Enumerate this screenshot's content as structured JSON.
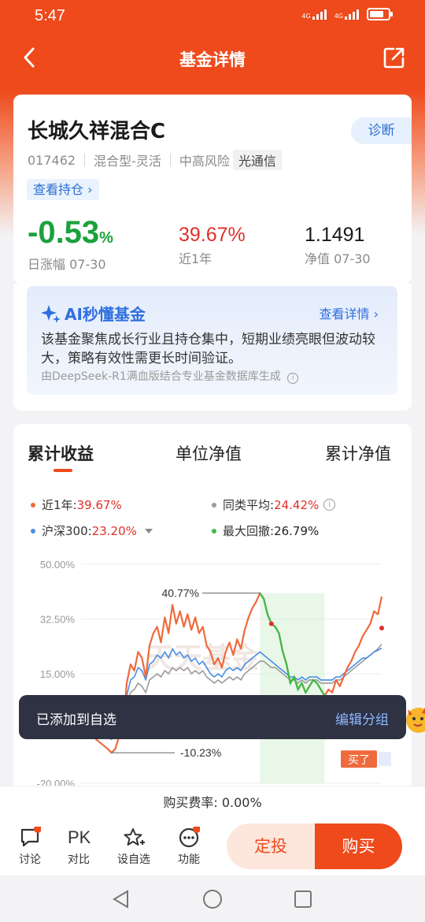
{
  "status_bar": {
    "time": "5:47",
    "signal1": "4G",
    "signal2": "4G"
  },
  "nav": {
    "title": "基金详情"
  },
  "fund": {
    "name": "长城久祥混合C",
    "diagnose": "诊断",
    "code": "017462",
    "type": "混合型-灵活",
    "risk": "中高风险",
    "manager_tag": "光通信",
    "holdings_link": "查看持仓 ›",
    "daily_change_value": "-0.53",
    "daily_change_unit": "%",
    "daily_change_label": "日涨幅 07-30",
    "year_return": "39.67%",
    "year_return_label": "近1年",
    "nav_value": "1.1491",
    "nav_label": "净值 07-30"
  },
  "ai": {
    "title": "AI秒懂基金",
    "more": "查看详情 ›",
    "text": "该基金聚焦成长行业且持仓集中，短期业绩亮眼但波动较大，策略有效性需更长时间验证。",
    "note": "由DeepSeek-R1满血版结合专业基金数据库生成"
  },
  "chart_tabs": [
    "累计收益",
    "单位净值",
    "累计净值"
  ],
  "legend": {
    "fund_label": "近1年:",
    "fund_value": "39.67%",
    "peer_label": "同类平均:",
    "peer_value": "24.42%",
    "index_label": "沪深300:",
    "index_value": "23.20%",
    "drawdown_label": "最大回撤:",
    "drawdown_value": "26.79%"
  },
  "chart_data": {
    "type": "line",
    "y_tick_labels": [
      "50.00%",
      "32.50%",
      "15.00%",
      "-20.00%"
    ],
    "ylim": [
      -20,
      50
    ],
    "annotations": {
      "max": "40.77%",
      "min": "-10.23%"
    },
    "watermark": "天天基金",
    "buy_marker": "买了",
    "colors": {
      "fund": "#ef6a3c",
      "peer": "#9b9b9b",
      "index": "#4a8ee6",
      "drawdown": "#3dbb47"
    },
    "series": [
      {
        "name": "近1年",
        "values": [
          -2,
          -3,
          -5,
          -4,
          -6,
          -7,
          -8,
          -9,
          -10.23,
          -9,
          -5,
          -3,
          12,
          18,
          16,
          22,
          20,
          14,
          24,
          28,
          30,
          25,
          33,
          28,
          37,
          31,
          35,
          30,
          34,
          29,
          33,
          28,
          30,
          24,
          22,
          18,
          20,
          17,
          22,
          25,
          21,
          26,
          23,
          29,
          33,
          36,
          38,
          40.77,
          39,
          34,
          31,
          30,
          28,
          22,
          18,
          12,
          14,
          10,
          12,
          9,
          11,
          13,
          12,
          10,
          8,
          10,
          9,
          13,
          11,
          14,
          17,
          19,
          22,
          24,
          27,
          29,
          31,
          35,
          34,
          39.67
        ]
      },
      {
        "name": "同类平均",
        "values": [
          -1,
          -1.5,
          -2,
          -2,
          -3,
          -3.5,
          -4,
          -4,
          -4.5,
          -4,
          -2,
          0,
          6,
          9,
          10,
          12,
          11,
          9,
          13,
          14,
          15,
          14,
          16,
          15,
          17,
          16,
          17,
          16,
          17,
          15,
          16,
          15,
          16,
          14,
          13,
          12,
          13,
          12,
          13,
          14,
          13,
          14,
          13,
          15,
          16,
          17,
          18,
          19,
          19,
          18,
          17,
          17,
          16,
          15,
          14,
          13,
          13,
          12,
          13,
          12,
          13,
          13,
          13,
          12,
          12,
          12,
          12,
          13,
          13,
          14,
          15,
          16,
          17,
          18,
          19,
          20,
          21,
          22,
          23,
          24.42
        ]
      },
      {
        "name": "沪深300",
        "values": [
          -1,
          -2,
          -3,
          -3,
          -4,
          -4,
          -5,
          -5,
          -6,
          -5,
          -3,
          -1,
          8,
          13,
          14,
          17,
          16,
          13,
          18,
          19,
          21,
          20,
          22,
          20,
          23,
          21,
          22,
          20,
          21,
          19,
          20,
          18,
          19,
          17,
          15,
          14,
          15,
          14,
          16,
          17,
          16,
          17,
          16,
          18,
          19,
          20,
          21,
          22,
          21,
          20,
          19,
          18,
          17,
          16,
          15,
          14,
          14,
          13,
          14,
          13,
          14,
          14,
          14,
          13,
          13,
          13,
          13,
          14,
          14,
          15,
          16,
          17,
          18,
          19,
          20,
          20,
          21,
          22,
          22.5,
          23.2
        ]
      }
    ]
  },
  "toast": {
    "message": "已添加到自选",
    "action": "编辑分组"
  },
  "fee": {
    "text": "购买费率: 0.00%"
  },
  "bottom_bar": {
    "discuss": "讨论",
    "compare_icon": "PK",
    "compare": "对比",
    "watchlist": "设自选",
    "functions": "功能",
    "plan": "定投",
    "buy": "购买"
  }
}
